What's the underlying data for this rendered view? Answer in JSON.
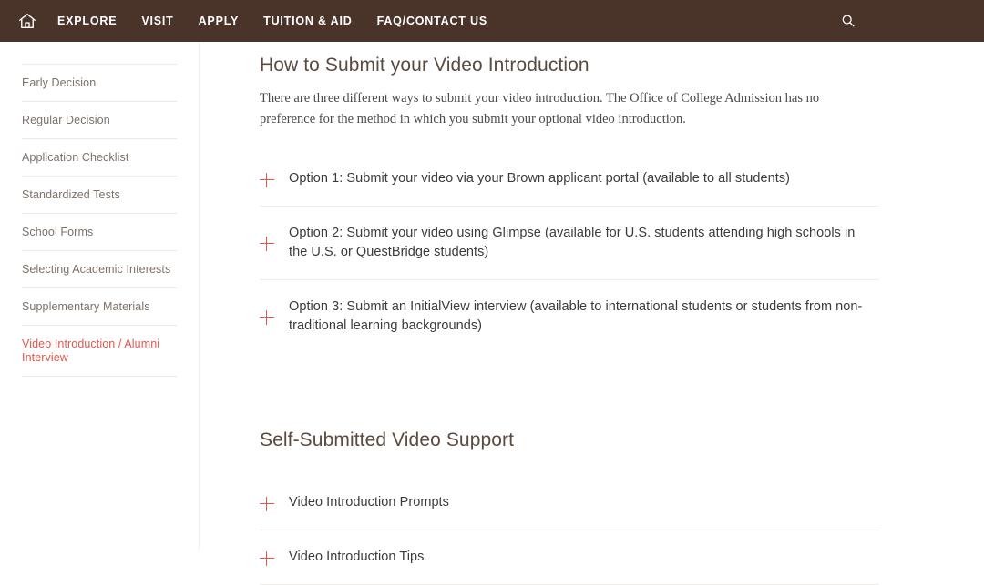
{
  "header": {
    "home_icon": "home-icon",
    "search_icon": "search-icon",
    "nav": [
      {
        "label": "EXPLORE"
      },
      {
        "label": "VISIT"
      },
      {
        "label": "APPLY"
      },
      {
        "label": "TUITION & AID"
      },
      {
        "label": "FAQ/CONTACT US"
      }
    ],
    "background_color": "#4a3328",
    "text_color": "#ffffff"
  },
  "sidebar": {
    "items": [
      {
        "label": "Early Decision",
        "active": false
      },
      {
        "label": "Regular Decision",
        "active": false
      },
      {
        "label": "Application Checklist",
        "active": false
      },
      {
        "label": "Standardized Tests",
        "active": false
      },
      {
        "label": "School Forms",
        "active": false
      },
      {
        "label": "Selecting Academic Interests",
        "active": false
      },
      {
        "label": "Supplementary Materials",
        "active": false
      },
      {
        "label": "Video Introduction / Alumni Interview",
        "active": true
      }
    ],
    "active_color": "#e2574c",
    "item_color": "#7d7169"
  },
  "main": {
    "heading": "How to Submit your Video Introduction",
    "intro_paragraph": "There are three different ways to submit your video introduction. The Office of College Admission has no preference for the method in which you submit your optional video introduction.",
    "options": [
      {
        "label": "Option 1: Submit your video via your Brown applicant portal (available to all students)",
        "icon": "plus-icon"
      },
      {
        "label": "Option 2: Submit your video using Glimpse (available for U.S. students attending high schools in the U.S. or QuestBridge students)",
        "icon": "plus-icon"
      },
      {
        "label": "Option 3: Submit an InitialView interview (available to international students or students from non-traditional learning backgrounds)",
        "icon": "plus-icon"
      }
    ],
    "support_heading": "Self-Submitted Video Support",
    "support_items": [
      {
        "label": "Video Introduction Prompts",
        "icon": "plus-icon"
      },
      {
        "label": "Video Introduction Tips",
        "icon": "plus-icon"
      }
    ],
    "heading_color": "#5b4a40",
    "accent_color": "#e2574c"
  }
}
